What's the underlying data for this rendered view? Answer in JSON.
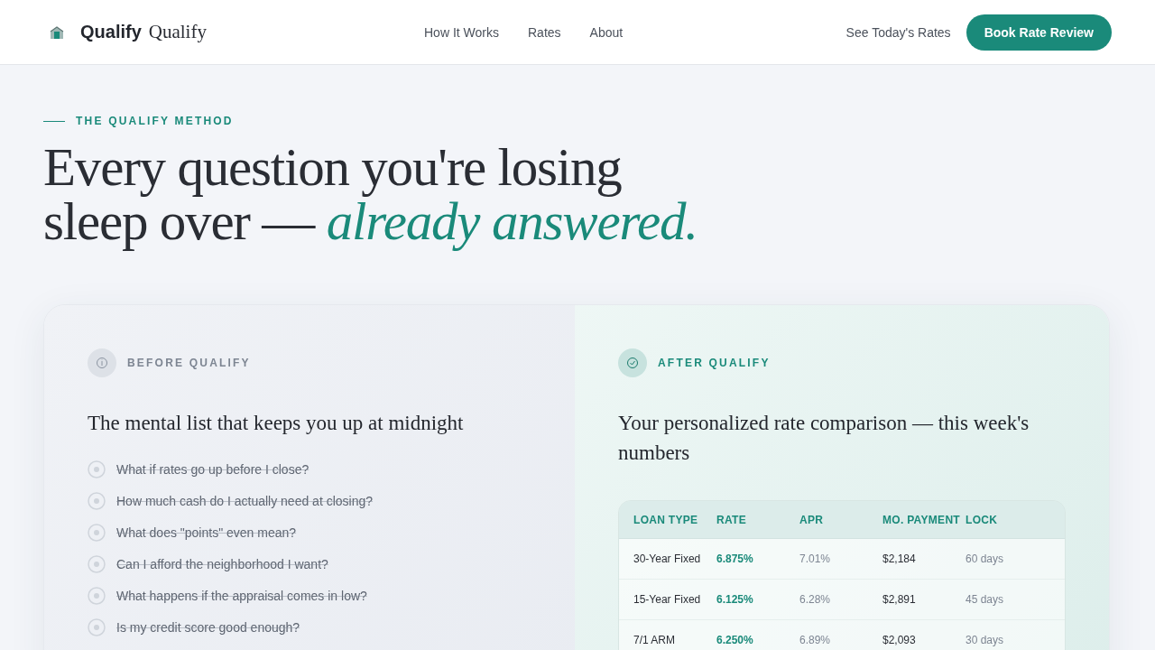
{
  "header": {
    "brand": "Qualify",
    "brand_serif": "Qualify",
    "nav": [
      {
        "label": "How It Works"
      },
      {
        "label": "Rates"
      },
      {
        "label": "About"
      }
    ],
    "link": "See Today's Rates",
    "cta": "Book Rate Review"
  },
  "hero": {
    "eyebrow": "THE QUALIFY METHOD",
    "headline_1": "Every question you're losing",
    "headline_2": "sleep over — *already answered.*"
  },
  "before": {
    "label": "BEFORE QUALIFY",
    "title": "The mental list that keeps you up at midnight",
    "items": [
      {
        "text": "What if rates go up before I close?",
        "struck": true
      },
      {
        "text": "How much cash do I actually need at closing?",
        "struck": true
      },
      {
        "text": "What does \"points\" even mean?",
        "struck": true
      },
      {
        "text": "Can I afford the neighborhood I want?",
        "struck": true
      },
      {
        "text": "What happens if the appraisal comes in low?",
        "struck": true
      },
      {
        "text": "Is my credit score good enough?",
        "struck": true
      }
    ]
  },
  "after": {
    "label": "AFTER QUALIFY",
    "title": "Your personalized rate comparison — this week's numbers",
    "table": {
      "columns": [
        "LOAN TYPE",
        "RATE",
        "APR",
        "MO. PAYMENT",
        "LOCK"
      ],
      "rows": [
        [
          "30-Year Fixed",
          "6.875%",
          "7.01%",
          "$2,184",
          "60 days"
        ],
        [
          "15-Year Fixed",
          "6.125%",
          "6.28%",
          "$2,891",
          "45 days"
        ],
        [
          "7/1 ARM",
          "6.250%",
          "6.89%",
          "$2,093",
          "30 days"
        ]
      ]
    }
  }
}
